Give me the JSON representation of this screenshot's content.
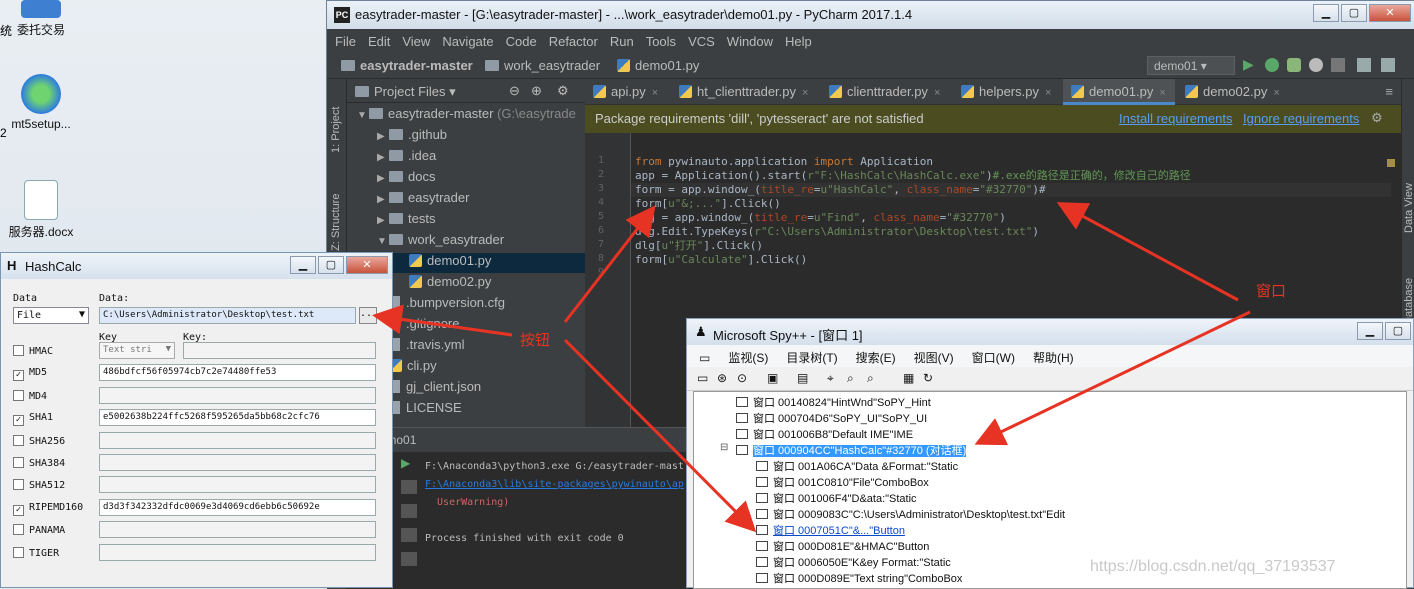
{
  "desktop": {
    "icons": [
      {
        "label": "委托交易"
      },
      {
        "label": "mt5setup..."
      },
      {
        "label": "服务器.docx"
      }
    ],
    "partial_labels": [
      "统",
      "2"
    ]
  },
  "pycharm": {
    "title": "easytrader-master - [G:\\easytrader-master] - ...\\work_easytrader\\demo01.py - PyCharm 2017.1.4",
    "logo": "PC",
    "win_buttons": {
      "minimize": "▁",
      "maximize": "▢",
      "close": "✕"
    },
    "menu": [
      "File",
      "Edit",
      "View",
      "Navigate",
      "Code",
      "Refactor",
      "Run",
      "Tools",
      "VCS",
      "Window",
      "Help"
    ],
    "breadcrumbs": [
      "easytrader-master",
      "work_easytrader",
      "demo01.py"
    ],
    "run_config": "demo01 ▾",
    "side_labels": {
      "project": "1: Project",
      "structure": "Z: Structure",
      "database": "Database",
      "data_view": "Data View"
    },
    "project_panel": {
      "header": "Project Files ▾",
      "tree": [
        {
          "label": "easytrader-master",
          "suffix": "(G:\\easytrade",
          "type": "folder",
          "arrow": "▼",
          "depth": 0
        },
        {
          "label": ".github",
          "type": "folder",
          "arrow": "▶",
          "depth": 1
        },
        {
          "label": ".idea",
          "type": "folder",
          "arrow": "▶",
          "depth": 1
        },
        {
          "label": "docs",
          "type": "folder",
          "arrow": "▶",
          "depth": 1
        },
        {
          "label": "easytrader",
          "type": "folder",
          "arrow": "▶",
          "depth": 1
        },
        {
          "label": "tests",
          "type": "folder",
          "arrow": "▶",
          "depth": 1
        },
        {
          "label": "work_easytrader",
          "type": "folder",
          "arrow": "▼",
          "depth": 1
        },
        {
          "label": "demo01.py",
          "type": "py",
          "arrow": "",
          "depth": 2,
          "selected": true
        },
        {
          "label": "demo02.py",
          "type": "py",
          "arrow": "",
          "depth": 2
        },
        {
          "label": ".bumpversion.cfg",
          "type": "file",
          "arrow": "",
          "depth": 1
        },
        {
          "label": ".gitignore",
          "type": "file",
          "arrow": "",
          "depth": 1
        },
        {
          "label": ".travis.yml",
          "type": "file",
          "arrow": "",
          "depth": 1
        },
        {
          "label": "cli.py",
          "type": "py",
          "arrow": "",
          "depth": 1
        },
        {
          "label": "gj_client.json",
          "type": "file",
          "arrow": "",
          "depth": 1
        },
        {
          "label": "LICENSE",
          "type": "file",
          "arrow": "",
          "depth": 1
        }
      ]
    },
    "tabs": [
      {
        "label": "api.py"
      },
      {
        "label": "ht_clienttrader.py"
      },
      {
        "label": "clienttrader.py"
      },
      {
        "label": "helpers.py"
      },
      {
        "label": "demo01.py",
        "active": true
      },
      {
        "label": "demo02.py"
      }
    ],
    "tab_close": "×",
    "banner": {
      "message": "Package requirements 'dill', 'pytesseract' are not satisfied",
      "install": "Install requirements",
      "ignore": "Ignore requirements"
    },
    "line_numbers": [
      "1",
      "2",
      "3",
      "4",
      "5",
      "6",
      "7",
      "8",
      "9"
    ],
    "code_lines": [
      [
        {
          "t": "from",
          "c": "kw"
        },
        {
          "t": " pywinauto.application ",
          "c": ""
        },
        {
          "t": "import",
          "c": "kw"
        },
        {
          "t": " Application",
          "c": ""
        }
      ],
      [
        {
          "t": "app = Application().start(",
          "c": ""
        },
        {
          "t": "r\"F:\\HashCalc\\HashCalc.exe\"",
          "c": "str"
        },
        {
          "t": ")",
          "c": ""
        },
        {
          "t": "#.exe的路径是正确的，修改自己的路径",
          "c": "cmt"
        }
      ],
      [
        {
          "t": "form = app.window_(",
          "c": ""
        },
        {
          "t": "title_re",
          "c": "prm"
        },
        {
          "t": "=",
          "c": ""
        },
        {
          "t": "u\"HashCalc\"",
          "c": "str"
        },
        {
          "t": ", ",
          "c": ""
        },
        {
          "t": "class_name",
          "c": "prm"
        },
        {
          "t": "=",
          "c": ""
        },
        {
          "t": "\"#32770\"",
          "c": "str"
        },
        {
          "t": ")#",
          "c": ""
        }
      ],
      [
        {
          "t": "form[",
          "c": ""
        },
        {
          "t": "u\"&;...\"",
          "c": "str"
        },
        {
          "t": "].Click()",
          "c": ""
        }
      ],
      [
        {
          "t": "dlg = app.window_(",
          "c": ""
        },
        {
          "t": "title_re",
          "c": "prm"
        },
        {
          "t": "=",
          "c": ""
        },
        {
          "t": "u\"Find\"",
          "c": "str"
        },
        {
          "t": ", ",
          "c": ""
        },
        {
          "t": "class_name",
          "c": "prm"
        },
        {
          "t": "=",
          "c": ""
        },
        {
          "t": "\"#32770\"",
          "c": "str"
        },
        {
          "t": ")",
          "c": ""
        }
      ],
      [
        {
          "t": "dlg.Edit.TypeKeys(",
          "c": ""
        },
        {
          "t": "r\"C:\\Users\\Administrator\\Desktop\\test.txt\"",
          "c": "str"
        },
        {
          "t": ")",
          "c": ""
        }
      ],
      [
        {
          "t": "dlg[",
          "c": ""
        },
        {
          "t": "u\"打开\"",
          "c": "str"
        },
        {
          "t": "].Click()",
          "c": ""
        }
      ],
      [
        {
          "t": "form[",
          "c": ""
        },
        {
          "t": "u\"Calculate\"",
          "c": "str"
        },
        {
          "t": "].Click()",
          "c": ""
        }
      ]
    ],
    "run_panel": {
      "title": "demo01",
      "lines": [
        {
          "text": "F:\\Anaconda3\\python3.exe G:/easytrader-mast",
          "cls": ""
        },
        {
          "text": "F:\\Anaconda3\\lib\\site-packages\\pywinauto\\ap",
          "cls": "link"
        },
        {
          "text": "  UserWarning)",
          "cls": "err"
        },
        {
          "text": "",
          "cls": ""
        },
        {
          "text": "Process finished with exit code 0",
          "cls": ""
        }
      ]
    }
  },
  "hashcalc": {
    "title": "HashCalc",
    "icon": "H",
    "data_label": "Data",
    "data_label2": "Data:",
    "data_format": "File",
    "data_value": "C:\\Users\\Administrator\\Desktop\\test.txt",
    "browse_button": "...",
    "key_label": "Key",
    "key_label2": "Key:",
    "key_format": "Text stri",
    "rows": [
      {
        "name": "HMAC",
        "checked": false,
        "value": ""
      },
      {
        "name": "MD5",
        "checked": true,
        "value": "486bdfcf56f05974cb7c2e74480ffe53"
      },
      {
        "name": "MD4",
        "checked": false,
        "value": ""
      },
      {
        "name": "SHA1",
        "checked": true,
        "value": "e5002638b224ffc5268f595265da5bb68c2cfc76"
      },
      {
        "name": "SHA256",
        "checked": false,
        "value": ""
      },
      {
        "name": "SHA384",
        "checked": false,
        "value": ""
      },
      {
        "name": "SHA512",
        "checked": false,
        "value": ""
      },
      {
        "name": "RIPEMD160",
        "checked": true,
        "value": "d3d3f342332dfdc0069e3d4069cd6ebb6c50692e"
      },
      {
        "name": "PANAMA",
        "checked": false,
        "value": ""
      },
      {
        "name": "TIGER",
        "checked": false,
        "value": ""
      }
    ]
  },
  "spy": {
    "title": "Microsoft Spy++ - [窗口 1]",
    "menu": [
      "监视(S)",
      "目录树(T)",
      "搜索(E)",
      "视图(V)",
      "窗口(W)",
      "帮助(H)"
    ],
    "tree": [
      {
        "text": "窗口 00140824\"HintWnd\"SoPY_Hint",
        "depth": 0
      },
      {
        "text": "窗口 000704D6\"SoPY_UI\"SoPY_UI",
        "depth": 0
      },
      {
        "text": "窗口 001006B8\"Default IME\"IME",
        "depth": 0
      },
      {
        "text": "窗口 000904CC\"HashCalc\"#32770 (对话框)",
        "depth": 0,
        "selected": true,
        "expander": "⊟"
      },
      {
        "text": "窗口 001A06CA\"Data &Format:\"Static",
        "depth": 1
      },
      {
        "text": "窗口 001C0810\"File\"ComboBox",
        "depth": 1
      },
      {
        "text": "窗口 001006F4\"D&ata:\"Static",
        "depth": 1
      },
      {
        "text": "窗口 0009083C\"C:\\Users\\Administrator\\Desktop\\test.txt\"Edit",
        "depth": 1
      },
      {
        "text": "窗口 0007051C\"&...\"Button",
        "depth": 1,
        "link": true
      },
      {
        "text": "窗口 000D081E\"&HMAC\"Button",
        "depth": 1
      },
      {
        "text": "窗口 0006050E\"K&ey Format:\"Static",
        "depth": 1
      },
      {
        "text": "窗口 000D089E\"Text string\"ComboBox",
        "depth": 1
      }
    ]
  },
  "annotations": {
    "button": "按钮",
    "window": "窗口"
  },
  "watermark": "https://blog.csdn.net/qq_37193537",
  "colors": {
    "arrow": "#e63323",
    "selection": "#3399ff",
    "editor_bg": "#2b2b2b"
  }
}
